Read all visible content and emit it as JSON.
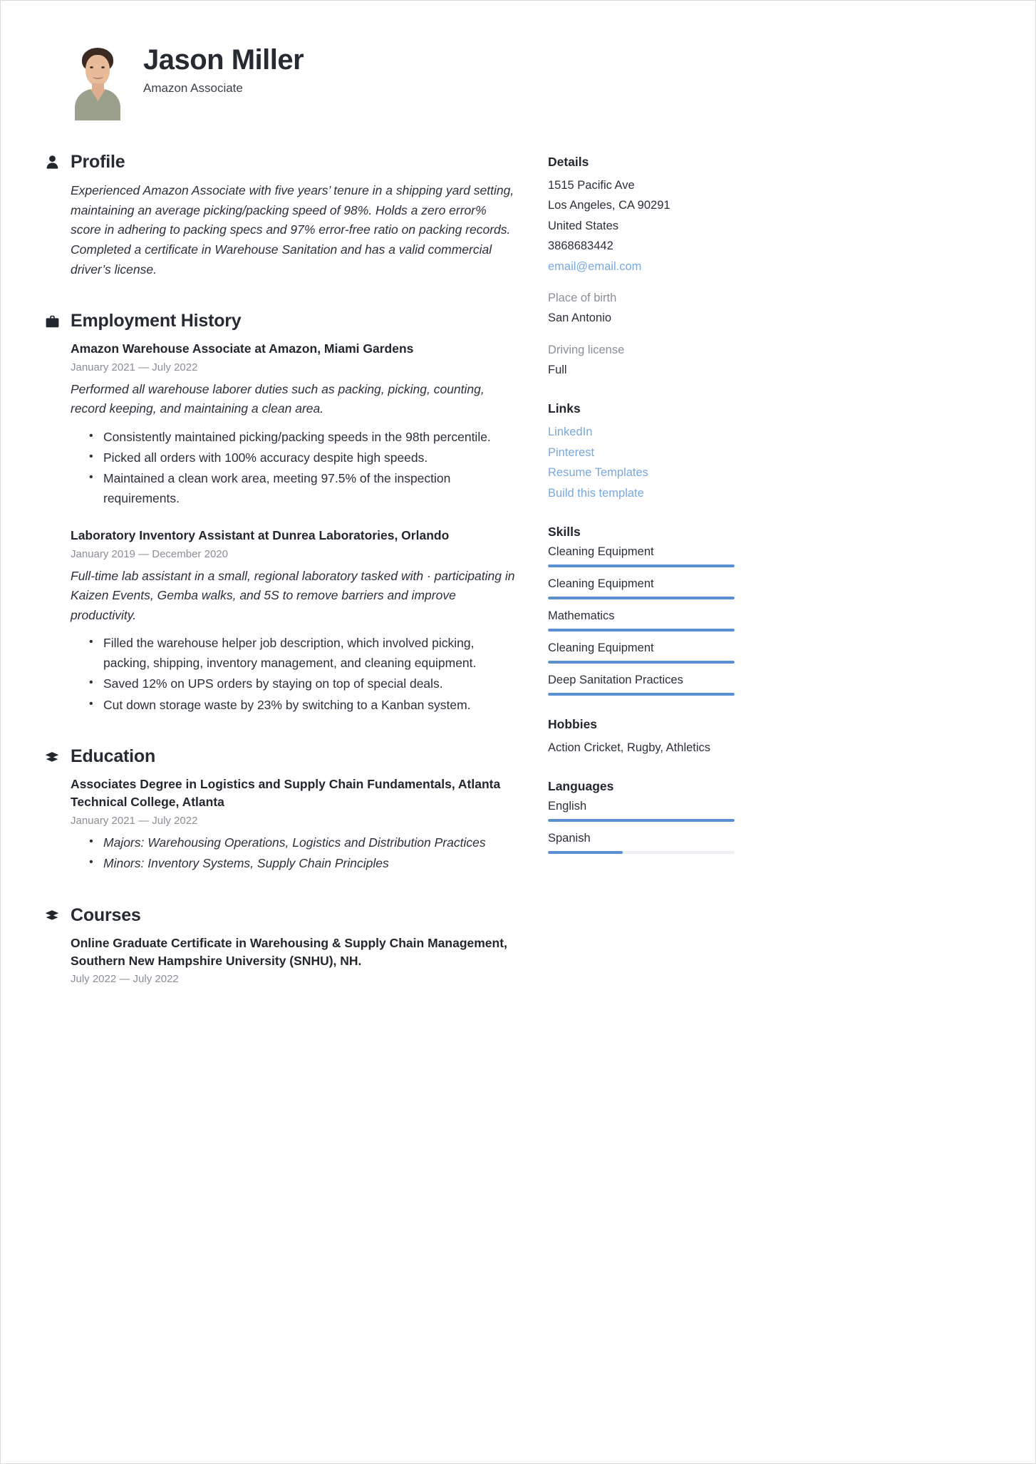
{
  "header": {
    "name": "Jason Miller",
    "job_title": "Amazon Associate",
    "photo_alt": "portrait-photo"
  },
  "accent_color": "#5b8fd4",
  "link_color": "#7aa9dd",
  "sections": {
    "profile": {
      "title": "Profile",
      "icon": "person-icon",
      "text": "Experienced Amazon Associate with five years’ tenure in a shipping yard setting, maintaining an average picking/packing speed of 98%. Holds a zero error% score in adhering to packing specs and 97% error-free ratio on packing records. Completed a certificate in Warehouse Sanitation and has a valid commercial driver’s license."
    },
    "employment": {
      "title": "Employment History",
      "icon": "briefcase-icon",
      "entries": [
        {
          "title": "Amazon Warehouse Associate at Amazon, Miami Gardens",
          "date": "January 2021 — July 2022",
          "description": "Performed all warehouse laborer duties such as packing, picking, counting, record keeping, and maintaining a clean area.",
          "bullets": [
            "Consistently maintained picking/packing speeds in the 98th percentile.",
            "Picked all orders with 100% accuracy despite high speeds.",
            "Maintained a clean work area, meeting 97.5% of the inspection requirements."
          ]
        },
        {
          "title": "Laboratory Inventory Assistant  at  Dunrea Laboratories, Orlando",
          "date": "January 2019 — December 2020",
          "description": "Full-time lab assistant in a small, regional laboratory tasked with · participating in Kaizen Events, Gemba walks, and 5S to remove barriers and improve productivity.",
          "bullets": [
            "Filled the warehouse helper job description, which involved picking, packing, shipping, inventory management, and cleaning equipment.",
            "Saved 12% on UPS orders by staying on top of special deals.",
            "Cut down storage waste by 23% by switching to a Kanban system."
          ]
        }
      ]
    },
    "education": {
      "title": "Education",
      "icon": "graduation-cap-icon",
      "entries": [
        {
          "title": "Associates Degree in Logistics and Supply Chain Fundamentals, Atlanta Technical College, Atlanta",
          "date": "January 2021 — July 2022",
          "bullets": [
            "Majors: Warehousing Operations, Logistics and Distribution Practices",
            "Minors: Inventory Systems, Supply Chain Principles"
          ]
        }
      ]
    },
    "courses": {
      "title": "Courses",
      "icon": "graduation-cap-icon",
      "entries": [
        {
          "title": "Online Graduate Certificate in Warehousing & Supply Chain Management, Southern New Hampshire University (SNHU), NH.",
          "date": "July 2022 — July 2022"
        }
      ]
    }
  },
  "sidebar": {
    "details": {
      "title": "Details",
      "address_line1": "1515 Pacific Ave",
      "address_line2": "Los Angeles, CA 90291",
      "country": "United States",
      "phone": "3868683442",
      "email": "email@email.com",
      "place_of_birth_label": "Place of birth",
      "place_of_birth": "San Antonio",
      "driving_license_label": "Driving license",
      "driving_license": "Full"
    },
    "links": {
      "title": "Links",
      "items": [
        {
          "label": "LinkedIn"
        },
        {
          "label": "Pinterest"
        },
        {
          "label": "Resume Templates"
        },
        {
          "label": "Build this template"
        }
      ]
    },
    "skills": {
      "title": "Skills",
      "items": [
        {
          "label": "Cleaning Equipment",
          "level": 100
        },
        {
          "label": "Cleaning Equipment",
          "level": 100
        },
        {
          "label": "Mathematics",
          "level": 100
        },
        {
          "label": "Cleaning Equipment",
          "level": 100
        },
        {
          "label": "Deep Sanitation Practices",
          "level": 100
        }
      ]
    },
    "hobbies": {
      "title": "Hobbies",
      "text": "Action Cricket, Rugby, Athletics"
    },
    "languages": {
      "title": "Languages",
      "items": [
        {
          "label": "English",
          "level": 100
        },
        {
          "label": "Spanish",
          "level": 40
        }
      ]
    }
  }
}
